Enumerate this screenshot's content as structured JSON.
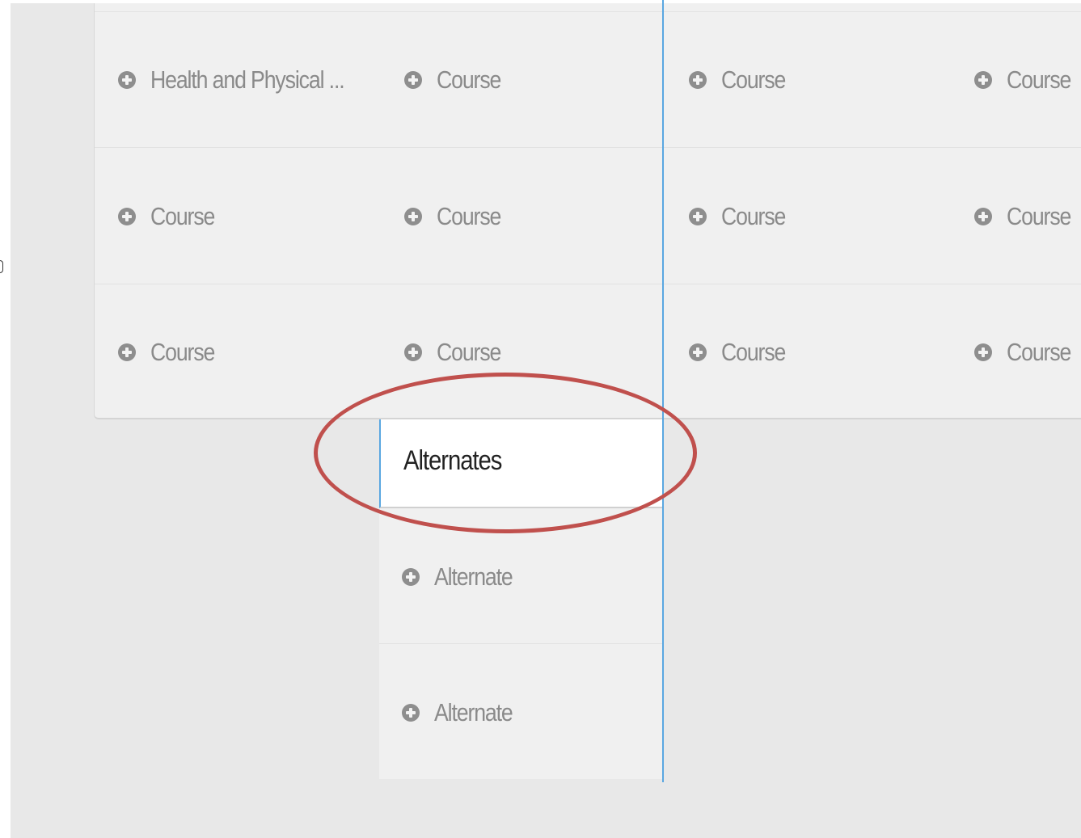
{
  "grid": {
    "rows": [
      [
        "Health and Physical ...",
        "Course",
        "Course",
        "Course"
      ],
      [
        "Course",
        "Course",
        "Course",
        "Course"
      ],
      [
        "Course",
        "Course",
        "Course",
        "Course"
      ]
    ]
  },
  "alternates": {
    "title": "Alternates",
    "items": [
      "Alternate",
      "Alternate"
    ]
  },
  "colors": {
    "divider": "#5aa7e1",
    "highlight": "#c0504d",
    "icon": "#8e8e8e"
  },
  "icons": {
    "add": "plus-circle-icon"
  }
}
